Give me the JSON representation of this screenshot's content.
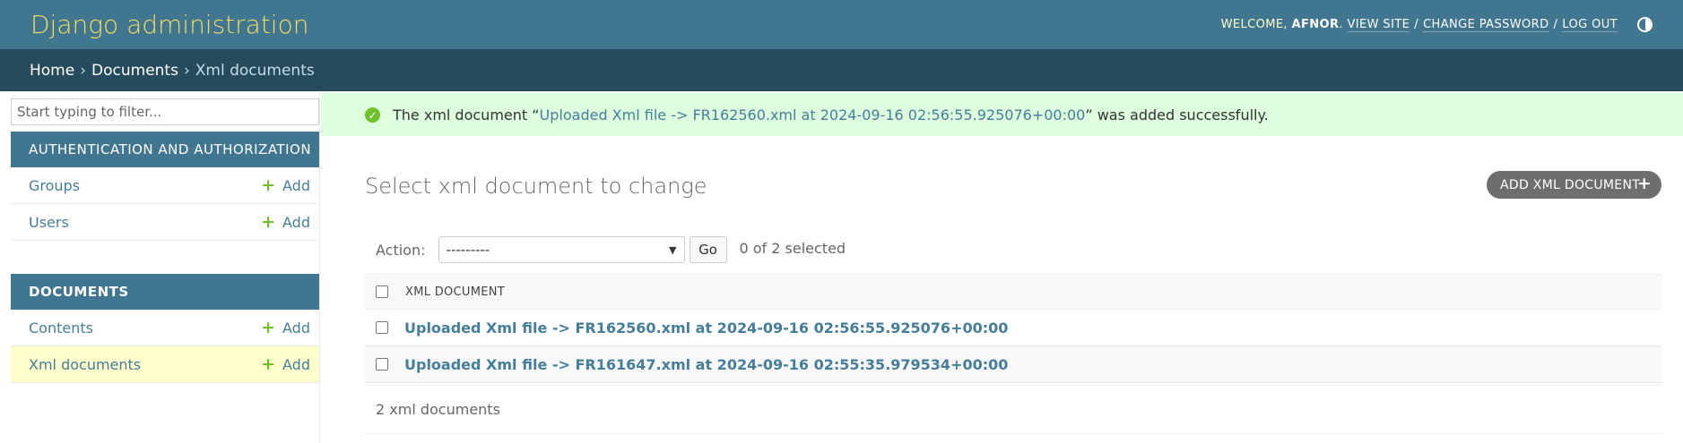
{
  "header": {
    "title": "Django administration",
    "welcome": "WELCOME,",
    "user": "AFNOR",
    "period": ".",
    "links": [
      "VIEW SITE",
      "CHANGE PASSWORD",
      "LOG OUT"
    ],
    "theme_icon": "theme-toggle-icon"
  },
  "breadcrumbs": {
    "items": [
      "Home",
      "Documents"
    ],
    "current": "Xml documents",
    "sep": "›"
  },
  "sidebar": {
    "filter_placeholder": "Start typing to filter...",
    "modules": [
      {
        "caption": "AUTHENTICATION AND AUTHORIZATION",
        "rows": [
          {
            "label": "Groups",
            "add": "Add"
          },
          {
            "label": "Users",
            "add": "Add"
          }
        ]
      },
      {
        "caption": "DOCUMENTS",
        "rows": [
          {
            "label": "Contents",
            "add": "Add"
          },
          {
            "label": "Xml documents",
            "add": "Add"
          }
        ]
      }
    ]
  },
  "message": {
    "prefix": "The xml document “",
    "link": "Uploaded Xml file -> FR162560.xml at 2024-09-16 02:56:55.925076+00:00",
    "suffix": "” was added successfully.",
    "icon": "check-icon"
  },
  "content": {
    "title": "Select xml document to change",
    "add_button": "ADD XML DOCUMENT",
    "action_label": "Action:",
    "action_value": "---------",
    "go": "Go",
    "selected": "0 of 2 selected",
    "column": "XML DOCUMENT",
    "rows": [
      "Uploaded Xml file -> FR162560.xml at 2024-09-16 02:56:55.925076+00:00",
      "Uploaded Xml file -> FR161647.xml at 2024-09-16 02:55:35.979534+00:00"
    ],
    "paginator": "2 xml documents"
  },
  "colors": {
    "header": "#417690",
    "breadcrumbs": "#264b5d",
    "branding": "#f5dd5d",
    "success_bg": "#dfd",
    "link": "#447e9b",
    "current_row": "#ffffcc"
  }
}
